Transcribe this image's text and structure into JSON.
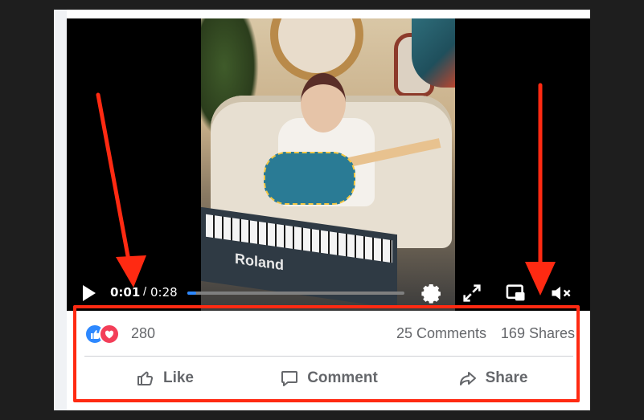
{
  "video": {
    "time_current": "0:01",
    "time_separator": "/",
    "time_total": "0:28",
    "progress_fraction": 0.04,
    "keyboard_brand": "Roland",
    "icons": {
      "play": "play-icon",
      "settings": "gear-icon",
      "fullscreen": "expand-icon",
      "pip": "picture-in-picture-icon",
      "mute": "muted-speaker-icon"
    }
  },
  "stats": {
    "reactions_count": "280",
    "comments": "25 Comments",
    "shares": "169 Shares"
  },
  "actions": {
    "like_label": "Like",
    "comment_label": "Comment",
    "share_label": "Share"
  },
  "colors": {
    "annotation_red": "#ff2a12",
    "facebook_blue": "#2d88ff",
    "love_red": "#f33e58",
    "muted_text": "#65676b"
  }
}
